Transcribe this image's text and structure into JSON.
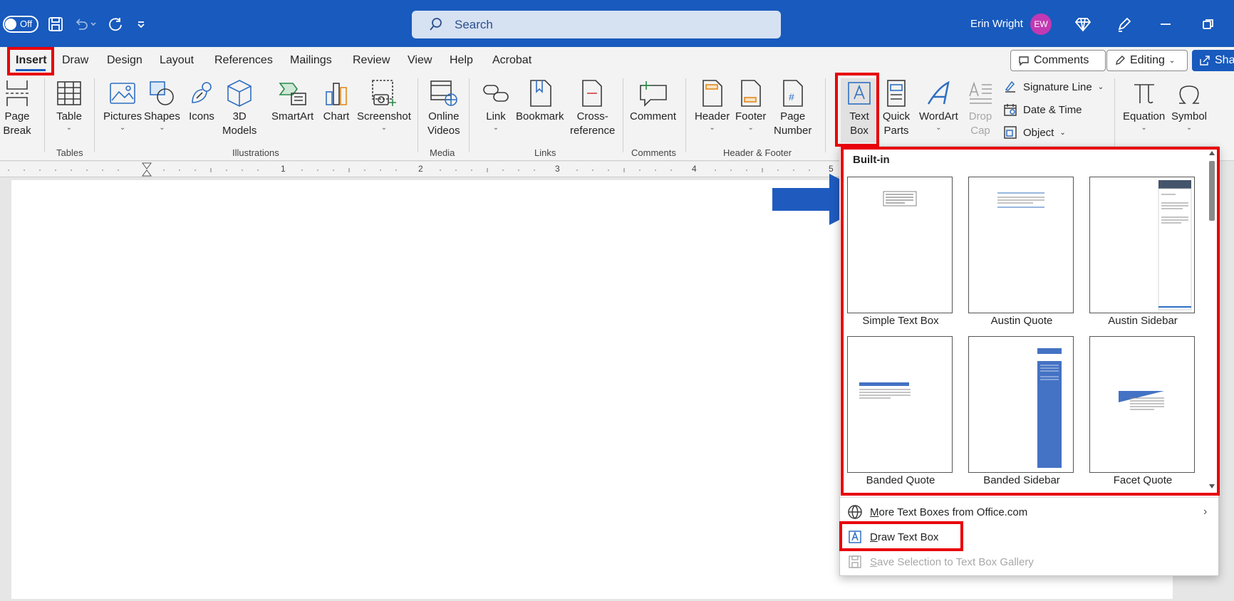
{
  "titlebar": {
    "autosave_label": "Off",
    "search_placeholder": "Search",
    "user_name": "Erin Wright",
    "user_initials": "EW"
  },
  "tabs": [
    "Insert",
    "Draw",
    "Design",
    "Layout",
    "References",
    "Mailings",
    "Review",
    "View",
    "Help",
    "Acrobat"
  ],
  "top_right": {
    "comments_label": "Comments",
    "editing_label": "Editing",
    "share_label": "Sha"
  },
  "ribbon": {
    "page_break": [
      "Page",
      "Break"
    ],
    "table": "Table",
    "pictures": "Pictures",
    "shapes": "Shapes",
    "icons": "Icons",
    "models": [
      "3D",
      "Models"
    ],
    "smartart": "SmartArt",
    "chart": "Chart",
    "screenshot": "Screenshot",
    "online_videos": [
      "Online",
      "Videos"
    ],
    "link": "Link",
    "bookmark": "Bookmark",
    "cross_reference": [
      "Cross-",
      "reference"
    ],
    "comment": "Comment",
    "header": "Header",
    "footer": "Footer",
    "page_number": [
      "Page",
      "Number"
    ],
    "text_box": [
      "Text",
      "Box"
    ],
    "quick_parts": [
      "Quick",
      "Parts"
    ],
    "wordart": "WordArt",
    "drop_cap": [
      "Drop",
      "Cap"
    ],
    "signature_line": "Signature Line",
    "date_time": "Date & Time",
    "object": "Object",
    "equation": "Equation",
    "symbol": "Symbol",
    "groups": {
      "tables": "Tables",
      "illustrations": "Illustrations",
      "media": "Media",
      "links": "Links",
      "comments": "Comments",
      "header_footer": "Header & Footer"
    }
  },
  "ruler": [
    "1",
    "2",
    "3",
    "4",
    "5"
  ],
  "dropdown": {
    "heading": "Built-in",
    "thumbnails": [
      {
        "label": "Simple Text Box"
      },
      {
        "label": "Austin Quote"
      },
      {
        "label": "Austin Sidebar"
      },
      {
        "label": "Banded Quote"
      },
      {
        "label": "Banded Sidebar"
      },
      {
        "label": "Facet Quote"
      }
    ],
    "more_text_boxes": "More Text Boxes from Office.com",
    "draw_text_box": "Draw Text Box",
    "save_selection": "Save Selection to Text Box Gallery"
  },
  "colors": {
    "title_bar": "#185abd",
    "highlight": "#e8000b",
    "annotation_arrow": "#1f5bbf"
  }
}
